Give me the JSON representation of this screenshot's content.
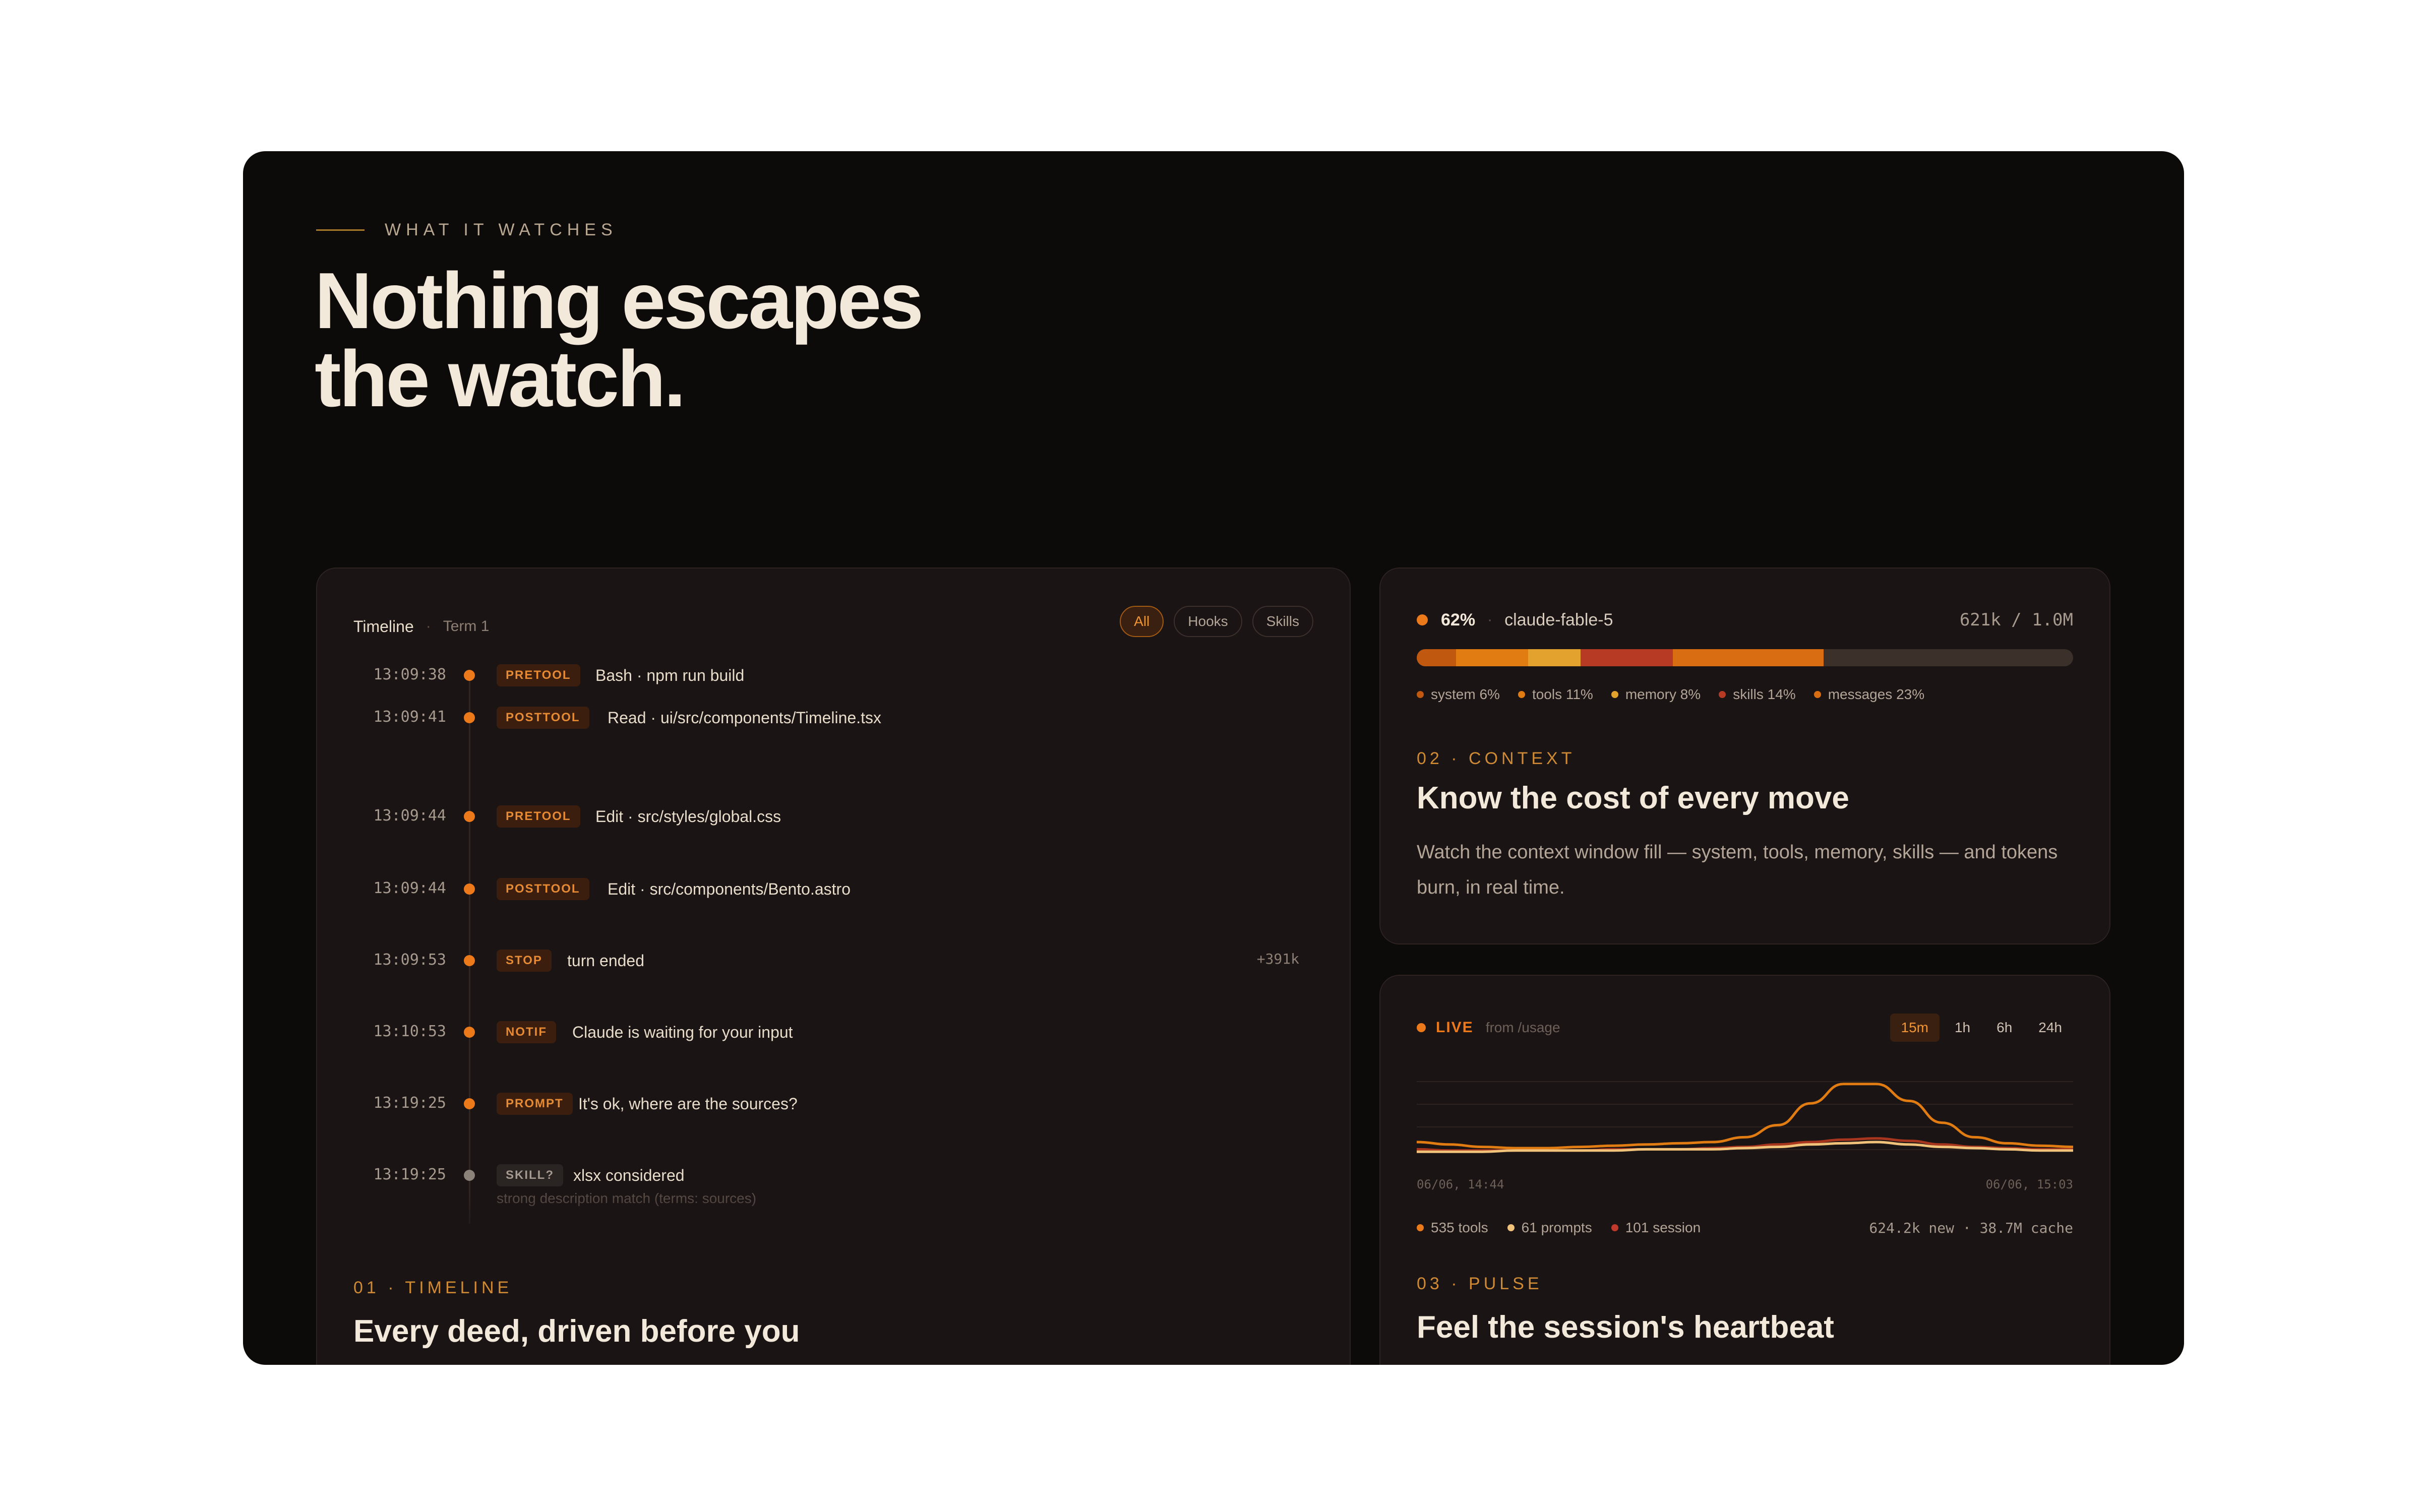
{
  "hero": {
    "eyebrow": "WHAT IT WATCHES",
    "headline_line1": "Nothing escapes",
    "headline_line2": "the watch."
  },
  "timeline_card": {
    "title": "Timeline",
    "term": "Term 1",
    "filters": [
      {
        "label": "All",
        "active": true
      },
      {
        "label": "Hooks",
        "active": false
      },
      {
        "label": "Skills",
        "active": false
      }
    ],
    "events": [
      {
        "time": "13:09:38",
        "type": "PRETOOL",
        "text": "Bash · npm run build",
        "sub": "",
        "meta": ""
      },
      {
        "time": "13:09:41",
        "type": "POSTTOOL",
        "text": "Read · ui/src/components/Timeline.tsx",
        "sub": "",
        "meta": ""
      },
      {
        "time": "13:09:44",
        "type": "PRETOOL",
        "text": "Edit · src/styles/global.css",
        "sub": "",
        "meta": ""
      },
      {
        "time": "13:09:44",
        "type": "POSTTOOL",
        "text": "Edit · src/components/Bento.astro",
        "sub": "",
        "meta": ""
      },
      {
        "time": "13:09:53",
        "type": "STOP",
        "text": "turn ended",
        "sub": "",
        "meta": "+391k"
      },
      {
        "time": "13:10:53",
        "type": "NOTIF",
        "text": "Claude is waiting for your input",
        "sub": "",
        "meta": ""
      },
      {
        "time": "13:19:25",
        "type": "PROMPT",
        "text": "It's ok, where are the sources?",
        "sub": "",
        "meta": ""
      },
      {
        "time": "13:19:25",
        "type": "SKILL?",
        "text": "xlsx considered",
        "sub": "strong description match (terms: sources)",
        "meta": ""
      }
    ],
    "eyebrow": "01 · TIMELINE",
    "heading": "Every deed, driven before you"
  },
  "context_card": {
    "percent": "62%",
    "model": "claude-fable-5",
    "tokens": "621k / 1.0M",
    "segments": [
      {
        "label": "system 6%",
        "value": 6,
        "color": "#c0580f"
      },
      {
        "label": "tools 11%",
        "value": 11,
        "color": "#e07c12"
      },
      {
        "label": "memory 8%",
        "value": 8,
        "color": "#e3a22e"
      },
      {
        "label": "skills 14%",
        "value": 14,
        "color": "#b63a24"
      },
      {
        "label": "messages 23%",
        "value": 23,
        "color": "#d96d11"
      }
    ],
    "eyebrow": "02 · CONTEXT",
    "heading": "Know the cost of every move",
    "description": "Watch the context window fill — system, tools, memory, skills — and tokens burn, in real time."
  },
  "pulse_card": {
    "live_label": "LIVE",
    "source": "from /usage",
    "ranges": [
      {
        "label": "15m",
        "active": true
      },
      {
        "label": "1h",
        "active": false
      },
      {
        "label": "6h",
        "active": false
      },
      {
        "label": "24h",
        "active": false
      }
    ],
    "axis_start": "06/06, 14:44",
    "axis_end": "06/06, 15:03",
    "stats": [
      {
        "label": "535 tools",
        "color": "#ec7a1b"
      },
      {
        "label": "61 prompts",
        "color": "#f1c27a"
      },
      {
        "label": "101 session",
        "color": "#c0392b"
      }
    ],
    "usage": "624.2k new · 38.7M cache",
    "eyebrow": "03 · PULSE",
    "heading": "Feel the session's heartbeat",
    "chart_data": {
      "type": "line",
      "x": [
        0,
        1,
        2,
        3,
        4,
        5,
        6,
        7,
        8,
        9,
        10,
        11,
        12,
        13,
        14,
        15,
        16,
        17,
        18,
        19,
        20
      ],
      "series": [
        {
          "values": [
            10,
            8,
            6,
            5,
            5,
            6,
            7,
            8,
            9,
            10,
            14,
            24,
            42,
            58,
            58,
            44,
            26,
            14,
            9,
            7,
            6
          ],
          "color": "#e07c12"
        },
        {
          "values": [
            4,
            3,
            3,
            3,
            3,
            3,
            4,
            4,
            4,
            5,
            6,
            8,
            10,
            12,
            13,
            11,
            8,
            6,
            5,
            4,
            4
          ],
          "color": "#a8361f"
        },
        {
          "values": [
            2,
            2,
            2,
            3,
            3,
            3,
            3,
            4,
            4,
            4,
            5,
            6,
            8,
            9,
            10,
            8,
            6,
            5,
            4,
            3,
            3
          ],
          "color": "#f1c27a"
        }
      ],
      "ylim": [
        0,
        70
      ]
    }
  }
}
